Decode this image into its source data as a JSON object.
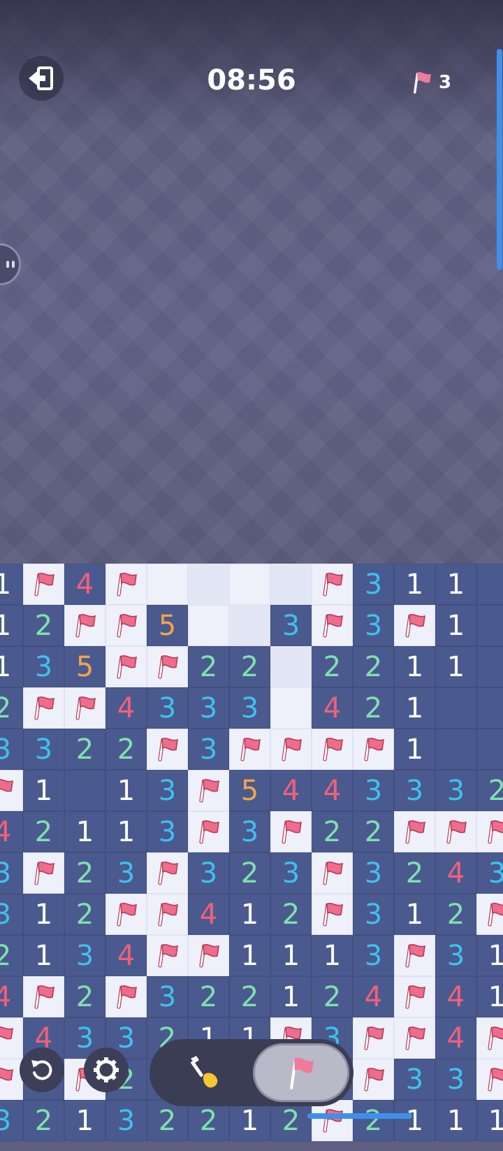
{
  "header": {
    "timer": "08:56",
    "flags_remaining": "3",
    "exit_icon": "exit-icon",
    "flag_icon": "flag-icon"
  },
  "board": {
    "rows": [
      [
        "1",
        "F",
        "4",
        "F",
        "C",
        "C",
        "C",
        "C",
        "F",
        "3",
        "1",
        "1",
        ""
      ],
      [
        "1",
        "2",
        "F",
        "F",
        "5",
        "C",
        "C",
        "3",
        "F",
        "3",
        "F",
        "1",
        ""
      ],
      [
        "1",
        "3",
        "5",
        "F",
        "F",
        "2",
        "2",
        "C",
        "2",
        "2",
        "1",
        "1",
        ""
      ],
      [
        "2",
        "F",
        "F",
        "4",
        "3",
        "3",
        "3",
        "C",
        "4",
        "2",
        "1",
        "",
        ""
      ],
      [
        "3",
        "3",
        "2",
        "2",
        "F",
        "3",
        "F",
        "F",
        "F",
        "F",
        "1",
        "",
        ""
      ],
      [
        "F",
        "1",
        "",
        "1",
        "3",
        "F",
        "5",
        "4",
        "4",
        "3",
        "3",
        "3",
        "2"
      ],
      [
        "4",
        "2",
        "1",
        "1",
        "3",
        "F",
        "3",
        "F",
        "2",
        "2",
        "F",
        "F",
        "F"
      ],
      [
        "3",
        "F",
        "2",
        "3",
        "F",
        "3",
        "2",
        "3",
        "F",
        "3",
        "2",
        "4",
        "3"
      ],
      [
        "3",
        "1",
        "2",
        "F",
        "F",
        "4",
        "1",
        "2",
        "F",
        "3",
        "1",
        "2",
        "F"
      ],
      [
        "2",
        "1",
        "3",
        "4",
        "F",
        "F",
        "1",
        "1",
        "1",
        "3",
        "F",
        "3",
        "1"
      ],
      [
        "4",
        "F",
        "2",
        "F",
        "3",
        "2",
        "2",
        "1",
        "2",
        "4",
        "F",
        "4",
        "1"
      ],
      [
        "F",
        "4",
        "3",
        "3",
        "2",
        "1",
        "1",
        "F",
        "3",
        "F",
        "F",
        "4",
        "F"
      ],
      [
        "F",
        "3",
        "F",
        "2",
        "2",
        "1",
        "1",
        "F",
        "3",
        "F",
        "3",
        "3",
        "F"
      ],
      [
        "3",
        "2",
        "1",
        "3",
        "2",
        "2",
        "1",
        "2",
        "F",
        "2",
        "1",
        "1",
        "1"
      ]
    ]
  },
  "controls": {
    "undo_icon": "undo-icon",
    "settings_icon": "gear-icon",
    "dig_icon": "shovel-icon",
    "flag_mode_icon": "flag-icon",
    "active_mode": "flag"
  }
}
